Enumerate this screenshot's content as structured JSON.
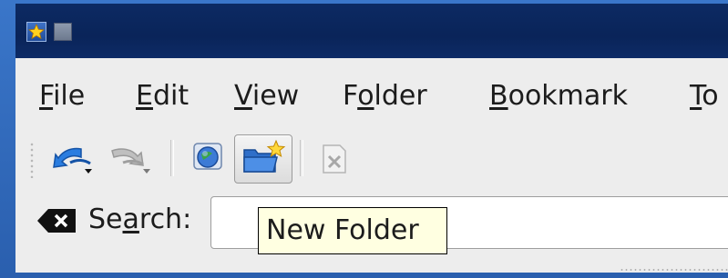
{
  "menu": {
    "items": [
      {
        "pre": "",
        "accel": "F",
        "post": "ile"
      },
      {
        "pre": "",
        "accel": "E",
        "post": "dit"
      },
      {
        "pre": "",
        "accel": "V",
        "post": "iew"
      },
      {
        "pre": "F",
        "accel": "o",
        "post": "lder"
      },
      {
        "pre": "",
        "accel": "B",
        "post": "ookmark"
      },
      {
        "pre": "",
        "accel": "T",
        "post": "o"
      }
    ]
  },
  "toolbar": {
    "buttons": [
      {
        "icon": "back-arrow-icon",
        "state": "enabled",
        "has_dropdown": true
      },
      {
        "icon": "forward-arrow-icon",
        "state": "disabled",
        "has_dropdown": true
      },
      {
        "icon": "globe-icon",
        "state": "enabled"
      },
      {
        "icon": "new-folder-icon",
        "state": "pressed"
      },
      {
        "icon": "delete-icon",
        "state": "disabled"
      }
    ]
  },
  "search": {
    "label_pre": "Se",
    "label_accel": "a",
    "label_post": "rch:",
    "value": "",
    "placeholder": ""
  },
  "tooltip": {
    "text": "New Folder"
  },
  "colors": {
    "titlebar": "#0a2459",
    "frame": "#2a63b8",
    "client": "#ededed",
    "tooltip_bg": "#ffffe1"
  }
}
